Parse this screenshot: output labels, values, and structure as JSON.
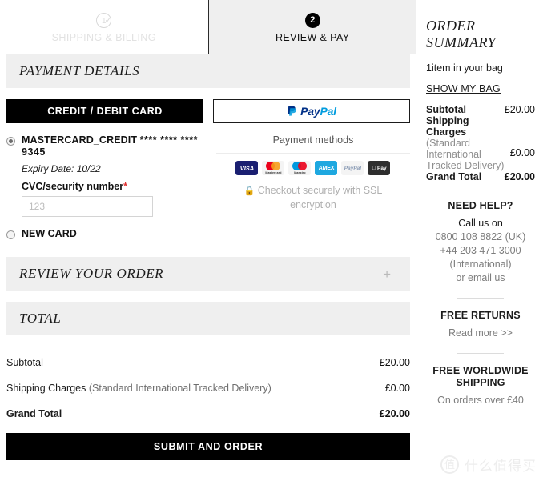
{
  "steps": [
    {
      "badge": "1",
      "label": "SHIPPING & BILLING",
      "state": "completed",
      "icon": "check-circle-icon"
    },
    {
      "badge": "2",
      "label": "REVIEW & PAY",
      "state": "active"
    }
  ],
  "sections": {
    "payment_details": "PAYMENT DETAILS",
    "review_your_order": "REVIEW YOUR ORDER",
    "review_expand_icon": "plus-icon",
    "total": "TOTAL"
  },
  "payment_tabs": {
    "card_label": "CREDIT / DEBIT CARD",
    "paypal_pay": "Pay",
    "paypal_pal": "Pal"
  },
  "saved_card": {
    "name": "MASTERCARD_CREDIT",
    "mask": "**** **** ****",
    "last4": "9345",
    "expiry": "Expiry Date: 10/22",
    "cvc_label": "CVC/security number",
    "cvc_required_mark": "*",
    "cvc_value": "",
    "cvc_placeholder": "123",
    "selected": true
  },
  "new_card": {
    "label": "NEW CARD",
    "selected": false
  },
  "payment_info": {
    "title": "Payment methods",
    "icons": [
      {
        "name": "visa-icon",
        "text": "VISA"
      },
      {
        "name": "mastercard-icon",
        "text": "Mastercard"
      },
      {
        "name": "maestro-icon",
        "text": "Maestro"
      },
      {
        "name": "amex-icon",
        "text": "AMEX"
      },
      {
        "name": "paypal-icon",
        "text": "PayPal"
      },
      {
        "name": "apple-pay-icon",
        "text": "Pay"
      }
    ],
    "ssl_lock_icon": "lock-icon",
    "ssl_text": "Checkout securely with SSL encryption"
  },
  "totals": {
    "subtotal_label": "Subtotal",
    "subtotal_value": "£20.00",
    "shipping_label": "Shipping Charges",
    "shipping_note": "(Standard International Tracked Delivery)",
    "shipping_value": "£0.00",
    "grand_label": "Grand Total",
    "grand_value": "£20.00"
  },
  "submit_button": "SUBMIT AND ORDER",
  "order_summary": {
    "title": "ORDER SUMMARY",
    "bag_count": "1item in your bag",
    "show_bag_link": "SHOW MY BAG",
    "subtotal_label": "Subtotal",
    "subtotal_value": "£20.00",
    "shipping_label": "Shipping Charges",
    "shipping_note": "(Standard International Tracked Delivery)",
    "shipping_value": "£0.00",
    "grand_label": "Grand Total",
    "grand_value": "£20.00"
  },
  "need_help": {
    "title": "NEED HELP?",
    "call_line": "Call us on",
    "phone_uk": "0800 108 8822 (UK)",
    "phone_intl": "+44 203 471 3000 (International)",
    "email_line": "or email us"
  },
  "free_returns": {
    "title": "FREE RETURNS",
    "link": "Read more >>"
  },
  "free_shipping": {
    "title": "FREE WORLDWIDE SHIPPING",
    "note": "On orders over £40"
  },
  "watermark": {
    "mark": "值",
    "text": "什么值得买"
  }
}
